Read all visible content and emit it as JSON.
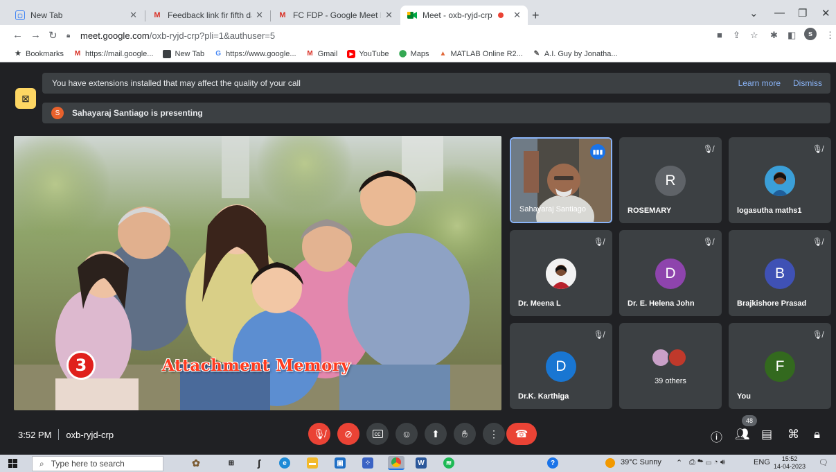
{
  "browser": {
    "tabs": [
      {
        "title": "New Tab",
        "icon": "new-tab-favicon",
        "active": false
      },
      {
        "title": "Feedback link fir fifth day - charis",
        "icon": "gmail-favicon",
        "active": false
      },
      {
        "title": "FC FDP - Google Meet Link - iqac",
        "icon": "gmail-favicon",
        "active": false
      },
      {
        "title": "Meet - oxb-ryjd-crp",
        "icon": "meet-favicon",
        "active": true
      }
    ],
    "url_domain": "meet.google.com",
    "url_path": "/oxb-ryjd-crp?pli=1&authuser=5",
    "profile_initial": "s",
    "bookmarks": [
      {
        "label": "Bookmarks",
        "icon": "star-icon"
      },
      {
        "label": "https://mail.google...",
        "icon": "gmail-icon"
      },
      {
        "label": "New Tab",
        "icon": "new-tab-icon"
      },
      {
        "label": "https://www.google...",
        "icon": "google-icon"
      },
      {
        "label": "Gmail",
        "icon": "gmail-icon"
      },
      {
        "label": "YouTube",
        "icon": "youtube-icon"
      },
      {
        "label": "Maps",
        "icon": "maps-icon"
      },
      {
        "label": "MATLAB Online R2...",
        "icon": "matlab-icon"
      },
      {
        "label": "A.I. Guy by Jonatha...",
        "icon": "ai-guy-icon"
      }
    ]
  },
  "meet": {
    "extension_banner": {
      "message": "You have extensions installed that may affect the quality of your call",
      "learn_more": "Learn more",
      "dismiss": "Dismiss"
    },
    "presenting": {
      "avatar_initial": "S",
      "message": "Sahayaraj Santiago is presenting"
    },
    "slide": {
      "number": "3",
      "caption": "Attachment Memory"
    },
    "participants": [
      {
        "name": "Sahayaraj Santiago",
        "type": "video",
        "speaking": true
      },
      {
        "name": "ROSEMARY",
        "initial": "R",
        "color": "#5f6368",
        "muted": true
      },
      {
        "name": "logasutha maths1",
        "type": "photo",
        "muted": true
      },
      {
        "name": "Dr. Meena L",
        "type": "photo",
        "muted": true
      },
      {
        "name": "Dr. E. Helena John",
        "initial": "D",
        "color": "#8e44ad",
        "muted": true
      },
      {
        "name": "Brajkishore Prasad",
        "initial": "B",
        "color": "#3f51b5",
        "muted": true
      },
      {
        "name": "Dr.K. Karthiga",
        "initial": "D",
        "color": "#1976d2",
        "muted": true
      },
      {
        "name": "39 others",
        "type": "others"
      },
      {
        "name": "You",
        "initial": "F",
        "color": "#33691e",
        "muted": true
      }
    ],
    "bottom_bar": {
      "time": "3:52 PM",
      "meeting_code": "oxb-ryjd-crp",
      "participant_count": "48"
    }
  },
  "taskbar": {
    "search_placeholder": "Type here to search",
    "weather": "39°C  Sunny",
    "language": "ENG",
    "time": "15:52",
    "date": "14-04-2023"
  },
  "colors": {
    "meet_bg": "#202124",
    "tile_bg": "#3c4043",
    "accent_blue": "#8ab4f8",
    "danger_red": "#ea4335"
  }
}
